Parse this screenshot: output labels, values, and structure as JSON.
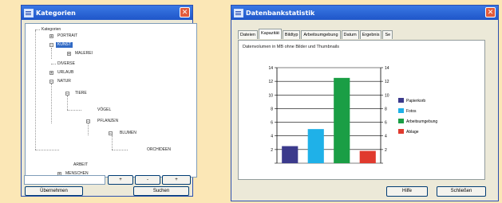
{
  "left_window": {
    "title": "Kategorien",
    "tree": [
      {
        "label": "Kategorien",
        "id": "root"
      },
      {
        "label": "PORTRAIT",
        "id": "portrait"
      },
      {
        "label": "KUNST",
        "id": "kunst",
        "selected": true
      },
      {
        "label": "MALEREI",
        "id": "malerei"
      },
      {
        "label": "DIVERSE",
        "id": "diverse"
      },
      {
        "label": "URLAUB",
        "id": "urlaub"
      },
      {
        "label": "NATUR",
        "id": "natur"
      },
      {
        "label": "TIERE",
        "id": "tiere"
      },
      {
        "label": "VÖGEL",
        "id": "voegel"
      },
      {
        "label": "PFLANZEN",
        "id": "pflanzen"
      },
      {
        "label": "BLUMEN",
        "id": "blumen"
      },
      {
        "label": "ORCHIDEEN",
        "id": "orchideen"
      },
      {
        "label": "ARBEIT",
        "id": "arbeit"
      },
      {
        "label": "MENSCHEN",
        "id": "menschen"
      }
    ],
    "input_value": "",
    "small_buttons": [
      "+",
      "-",
      "+"
    ],
    "btn_apply": "Übernehmen",
    "btn_search": "Suchen"
  },
  "right_window": {
    "title": "Datenbankstatistik",
    "tabs": [
      "Dateien",
      "Kapazität",
      "Bildtyp",
      "Arbeitsumgebung",
      "Datum",
      "Ergebnis",
      "Se"
    ],
    "active_tab": 1,
    "subtitle": "Datenvolumen in MB ohne Bilder und Thumbnails",
    "btn_help": "Hilfe",
    "btn_close": "Schließen"
  },
  "chart_data": {
    "type": "bar",
    "title": "",
    "ylim": [
      0,
      14
    ],
    "yticks": [
      0,
      2,
      4,
      6,
      8,
      10,
      12,
      14
    ],
    "ytick_labels": [
      "",
      "2",
      "4",
      "6",
      "8",
      "10",
      "12",
      "14"
    ],
    "grid": true,
    "legend_position": "right",
    "series": [
      {
        "name": "Papierkorb",
        "value": 2.5,
        "color": "#3B3A8C"
      },
      {
        "name": "Fotos",
        "value": 5,
        "color": "#1FB1E8"
      },
      {
        "name": "Arbeitsumgebung",
        "value": 12.5,
        "color": "#1A9E45"
      },
      {
        "name": "Ablage",
        "value": 1.8,
        "color": "#E03A2E"
      }
    ]
  }
}
